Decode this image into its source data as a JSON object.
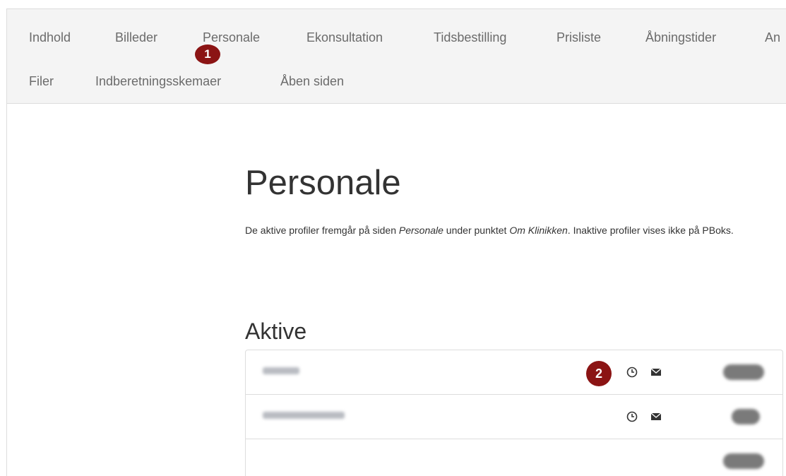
{
  "nav": {
    "row1": [
      "Indhold",
      "Billeder",
      "Personale",
      "Ekonsultation",
      "Tidsbestilling",
      "Prisliste",
      "Åbningstider",
      "An"
    ],
    "row2": [
      "Filer",
      "Indberetningsskemaer",
      "Åben siden"
    ]
  },
  "markers": {
    "one": "1",
    "two": "2"
  },
  "page": {
    "title": "Personale",
    "intro_part1": "De aktive profiler fremgår på siden ",
    "intro_em1": "Personale",
    "intro_part2": " under punktet ",
    "intro_em2": "Om Klinikken",
    "intro_part3": ". Inaktive profiler vises ikke på PBoks."
  },
  "section": {
    "title": "Aktive"
  },
  "staff_rows": [
    {
      "name_redacted": true,
      "icons": [
        "clock-icon",
        "envelope-icon"
      ],
      "status_redacted": true
    },
    {
      "name_redacted": true,
      "icons": [
        "clock-icon",
        "envelope-icon"
      ],
      "status_redacted": true
    },
    {
      "name_redacted": false,
      "icons": [],
      "status_redacted": true
    }
  ],
  "colors": {
    "marker": "#8b1414",
    "nav_bg": "#f4f4f4",
    "nav_text": "#6b6b6b"
  }
}
